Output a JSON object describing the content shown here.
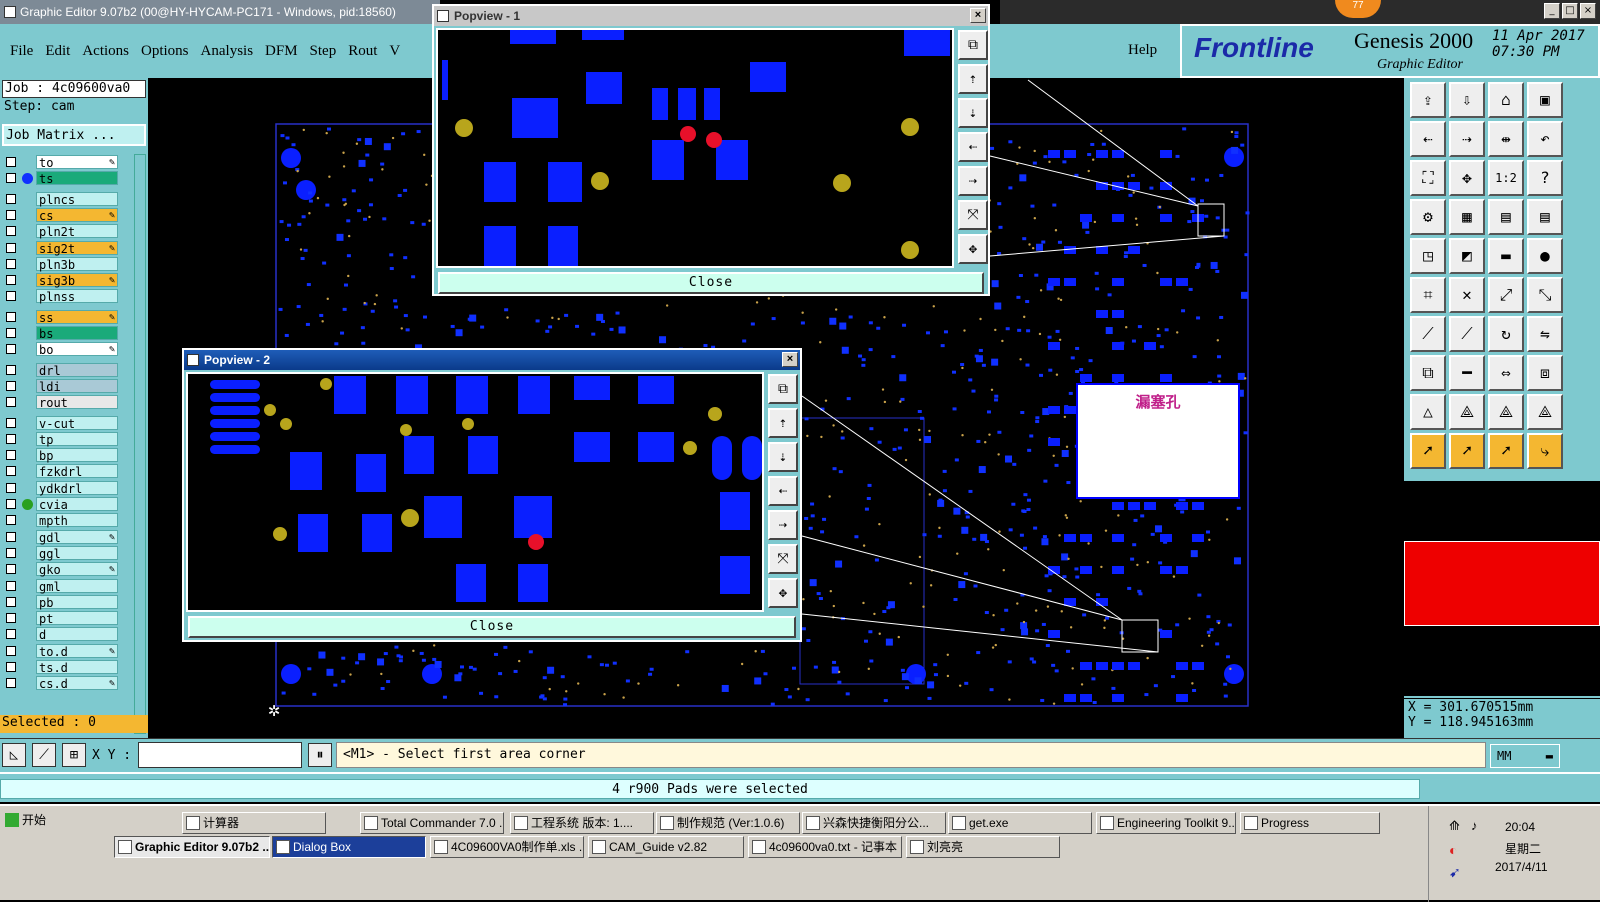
{
  "app": {
    "title": "Graphic Editor 9.07b2 (00@HY-HYCAM-PC171 - Windows, pid:18560)",
    "badge": "77"
  },
  "menu": [
    "File",
    "Edit",
    "Actions",
    "Options",
    "Analysis",
    "DFM",
    "Step",
    "Rout",
    "V"
  ],
  "help_label": "Help",
  "brand": {
    "logo": "Frontline",
    "name": "Genesis 2000",
    "sub": "Graphic Editor",
    "date_line1": "11 Apr 2017",
    "date_line2": "07:30 PM"
  },
  "job": {
    "job_label": "Job : 4c09600va0",
    "step_label": "Step: cam",
    "matrix_label": "Job Matrix ..."
  },
  "layers": [
    {
      "name": "to",
      "bg": "#ffffff",
      "pen": true,
      "dot": ""
    },
    {
      "name": "ts",
      "bg": "#1aaa7a",
      "pen": false,
      "dot": "#1030ff"
    },
    {
      "name": "plncs",
      "bg": "#bff0f0",
      "pen": false,
      "dot": ""
    },
    {
      "name": "cs",
      "bg": "#f4b731",
      "pen": true,
      "dot": ""
    },
    {
      "name": "pln2t",
      "bg": "#bff0f0",
      "pen": false,
      "dot": ""
    },
    {
      "name": "sig2t",
      "bg": "#f4b731",
      "pen": true,
      "dot": ""
    },
    {
      "name": "pln3b",
      "bg": "#bff0f0",
      "pen": false,
      "dot": ""
    },
    {
      "name": "sig3b",
      "bg": "#f4b731",
      "pen": true,
      "dot": ""
    },
    {
      "name": "plnss",
      "bg": "#bff0f0",
      "pen": false,
      "dot": ""
    },
    {
      "name": "ss",
      "bg": "#f4b731",
      "pen": true,
      "dot": ""
    },
    {
      "name": "bs",
      "bg": "#1aaa7a",
      "pen": false,
      "dot": ""
    },
    {
      "name": "bo",
      "bg": "#ffffff",
      "pen": true,
      "dot": ""
    },
    {
      "name": "drl",
      "bg": "#a9c9d6",
      "pen": false,
      "dot": ""
    },
    {
      "name": "ldi",
      "bg": "#a9c9d6",
      "pen": false,
      "dot": ""
    },
    {
      "name": "rout",
      "bg": "#e8e8e8",
      "pen": false,
      "dot": ""
    },
    {
      "name": "v-cut",
      "bg": "#bff0f0",
      "pen": false,
      "dot": ""
    },
    {
      "name": "tp",
      "bg": "#bff0f0",
      "pen": false,
      "dot": ""
    },
    {
      "name": "bp",
      "bg": "#bff0f0",
      "pen": false,
      "dot": ""
    },
    {
      "name": "fzkdrl",
      "bg": "#bff0f0",
      "pen": false,
      "dot": ""
    },
    {
      "name": "ydkdrl",
      "bg": "#bff0f0",
      "pen": false,
      "dot": ""
    },
    {
      "name": "cvia",
      "bg": "#bff0f0",
      "pen": false,
      "dot": "#2aa020"
    },
    {
      "name": "mpth",
      "bg": "#bff0f0",
      "pen": false,
      "dot": ""
    },
    {
      "name": "gdl",
      "bg": "#bff0f0",
      "pen": true,
      "dot": ""
    },
    {
      "name": "ggl",
      "bg": "#bff0f0",
      "pen": false,
      "dot": ""
    },
    {
      "name": "gko",
      "bg": "#bff0f0",
      "pen": true,
      "dot": ""
    },
    {
      "name": "gml",
      "bg": "#bff0f0",
      "pen": false,
      "dot": ""
    },
    {
      "name": "pb",
      "bg": "#bff0f0",
      "pen": false,
      "dot": ""
    },
    {
      "name": "pt",
      "bg": "#bff0f0",
      "pen": false,
      "dot": ""
    },
    {
      "name": "d",
      "bg": "#bff0f0",
      "pen": false,
      "dot": ""
    },
    {
      "name": "to.d",
      "bg": "#bff0f0",
      "pen": true,
      "dot": ""
    },
    {
      "name": "ts.d",
      "bg": "#bff0f0",
      "pen": false,
      "dot": ""
    },
    {
      "name": "cs.d",
      "bg": "#bff0f0",
      "pen": true,
      "dot": ""
    }
  ],
  "selected_label": "Selected : 0",
  "canvas": {
    "annotation": "漏塞孔"
  },
  "popview1": {
    "title": "Popview - 1",
    "close_label": "Close"
  },
  "popview2": {
    "title": "Popview - 2",
    "close_label": "Close"
  },
  "coords": {
    "x": "X = 301.670515mm",
    "y": "Y = 118.945163mm"
  },
  "cmd": {
    "xy_label": "X Y :",
    "xy_value": "",
    "prompt": "<M1> - Select first area corner",
    "units": "MM"
  },
  "status_message": "4 r900 Pads were selected",
  "taskbar": {
    "start": "开始",
    "row1": [
      "计算器",
      "Total Commander 7.0 ...",
      "工程系统  版本: 1....",
      "制作规范 (Ver:1.0.6)",
      "兴森快捷衡阳分公...",
      "get.exe",
      "Engineering Toolkit 9....",
      "Progress"
    ],
    "row2": [
      "Graphic Editor 9.07b2 ...",
      "Dialog Box",
      "4C09600VA0制作单.xls ...",
      "CAM_Guide v2.82",
      "4c09600va0.txt - 记事本",
      "刘亮亮"
    ],
    "clock": "20:04",
    "weekday": "星期二",
    "date": "2017/4/11"
  },
  "colors": {
    "panel": "#7ec9cf",
    "pad": "#0a1fff",
    "via": "#b8a51c",
    "selected_pad": "#e8102a",
    "highlight": "#f4b731"
  }
}
